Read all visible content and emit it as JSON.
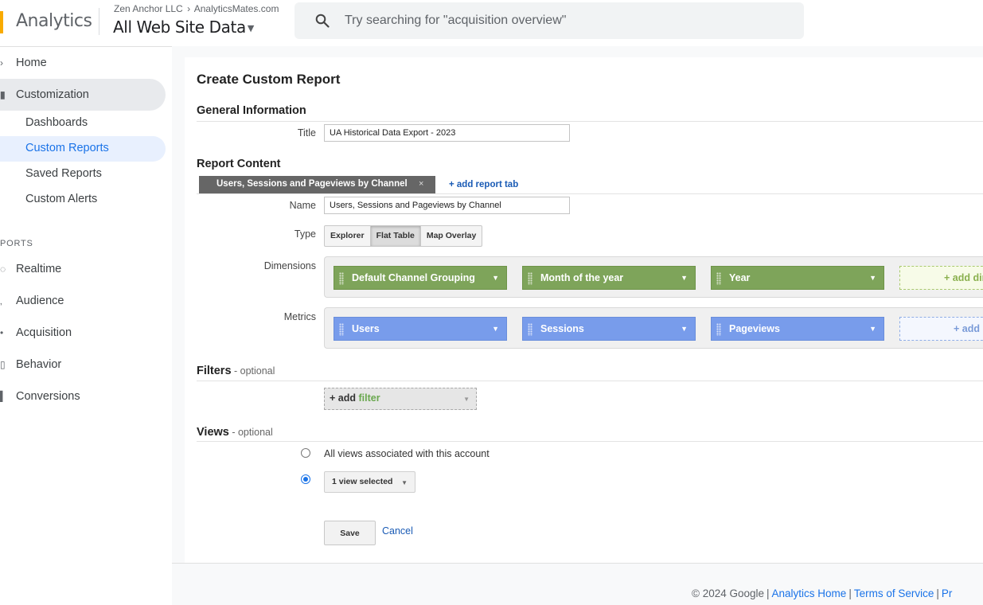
{
  "app": {
    "name": "Analytics",
    "account": "Zen Anchor LLC",
    "property_crumb": "AnalyticsMates.com",
    "view_name": "All Web Site Data",
    "search_placeholder": "Try searching for \"acquisition overview\""
  },
  "sidebar": {
    "home": "Home",
    "customization": "Customization",
    "sub_items": [
      {
        "label": "Dashboards",
        "active": false
      },
      {
        "label": "Custom Reports",
        "active": true
      },
      {
        "label": "Saved Reports",
        "active": false
      },
      {
        "label": "Custom Alerts",
        "active": false
      }
    ],
    "reports_section": "PORTS",
    "report_items": [
      {
        "label": "Realtime",
        "icon": "clock-icon"
      },
      {
        "label": "Audience",
        "icon": "person-icon"
      },
      {
        "label": "Acquisition",
        "icon": "acquisition-icon"
      },
      {
        "label": "Behavior",
        "icon": "behavior-icon"
      },
      {
        "label": "Conversions",
        "icon": "flag-icon"
      }
    ]
  },
  "form": {
    "page_title": "Create Custom Report",
    "general_heading": "General Information",
    "title_label": "Title",
    "title_value": "UA Historical Data Export - 2023",
    "content_heading": "Report Content",
    "tab_label": "Users, Sessions and Pageviews by Channel",
    "tab_close": "×",
    "add_tab": "+ add report tab",
    "name_label": "Name",
    "name_value": "Users, Sessions and Pageviews by Channel",
    "type_label": "Type",
    "type_options": [
      {
        "label": "Explorer",
        "selected": false
      },
      {
        "label": "Flat Table",
        "selected": true
      },
      {
        "label": "Map Overlay",
        "selected": false
      }
    ],
    "dimensions_label": "Dimensions",
    "dimensions": [
      "Default Channel Grouping",
      "Month of the year",
      "Year"
    ],
    "add_dimension": "+ add dimension",
    "metrics_label": "Metrics",
    "metrics": [
      "Users",
      "Sessions",
      "Pageviews"
    ],
    "add_metric": "+ add metric",
    "filters_heading": "Filters",
    "filters_optional": " - optional",
    "add_filter_plus": "+ add ",
    "add_filter_word": "filter",
    "views_heading": "Views",
    "views_optional": " - optional",
    "view_option_all": "All views associated with this account",
    "view_option_selected": "1 view selected",
    "selected_view_option": "selected",
    "save": "Save",
    "cancel": "Cancel"
  },
  "footer": {
    "copyright": "© 2024 Google",
    "links": [
      "Analytics Home",
      "Terms of Service",
      "Pr"
    ]
  },
  "colors": {
    "dimension_pill": "#7ea45a",
    "metric_pill": "#789ceb",
    "link": "#1a73e8",
    "accent": "#f9ab00"
  }
}
